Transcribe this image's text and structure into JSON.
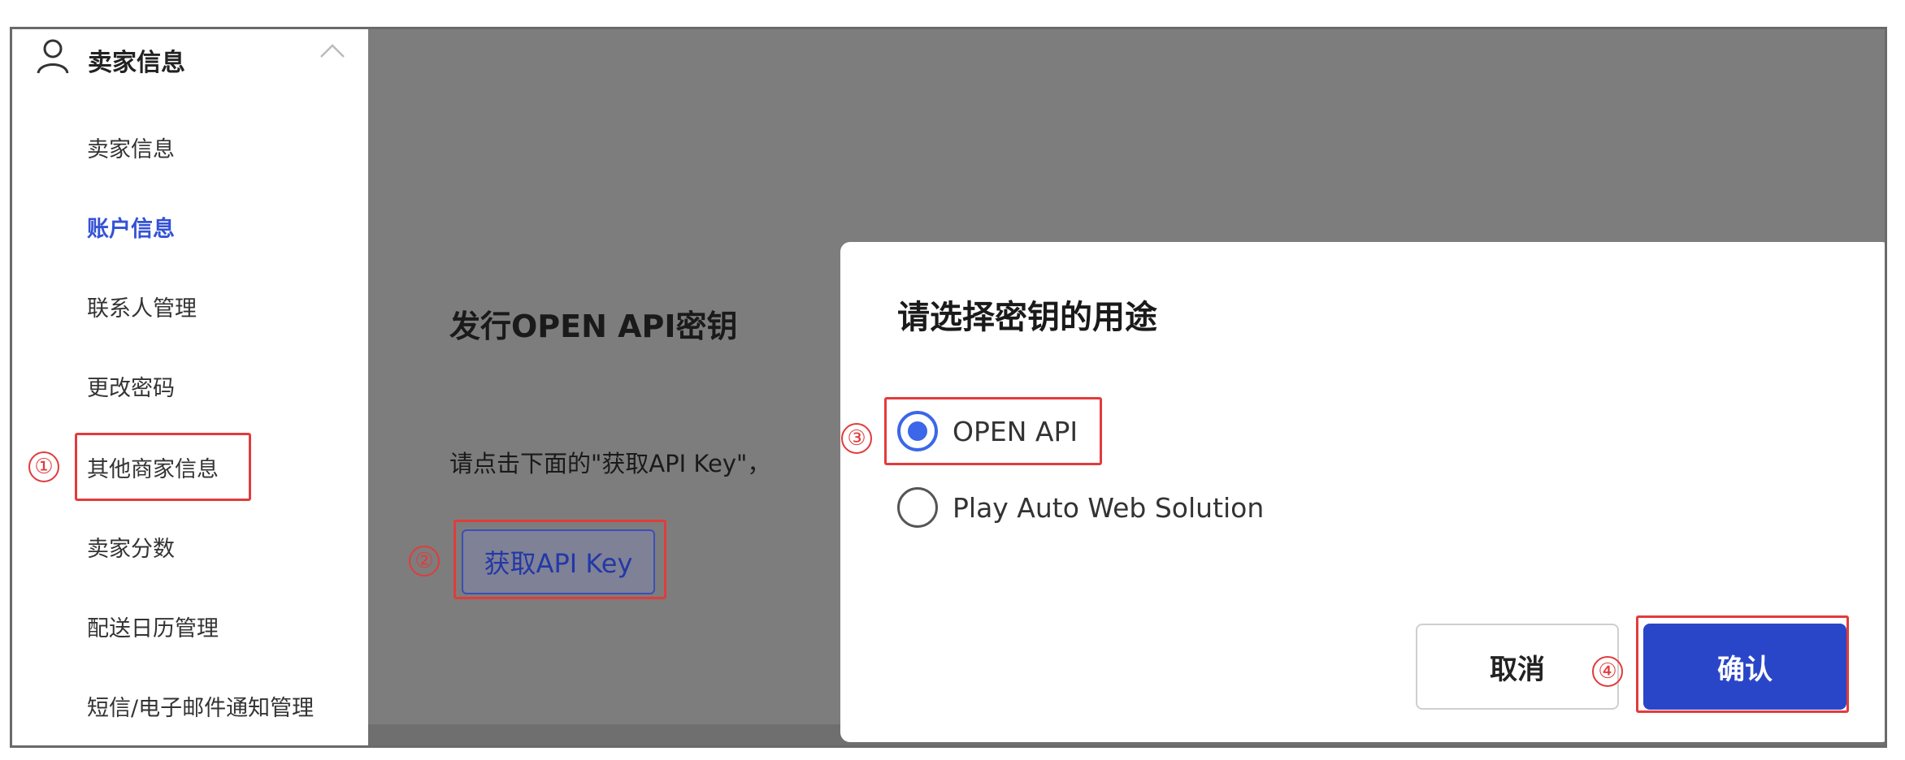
{
  "sidebar": {
    "header_title": "卖家信息",
    "items": [
      {
        "label": "卖家信息",
        "active": false
      },
      {
        "label": "账户信息",
        "active": true
      },
      {
        "label": "联系人管理",
        "active": false
      },
      {
        "label": "更改密码",
        "active": false
      },
      {
        "label": "其他商家信息",
        "active": false
      },
      {
        "label": "卖家分数",
        "active": false
      },
      {
        "label": "配送日历管理",
        "active": false
      },
      {
        "label": "短信/电子邮件通知管理",
        "active": false
      }
    ]
  },
  "background": {
    "title": "发行OPEN API密钥",
    "description": "请点击下面的\"获取API Key\"，",
    "get_key_button": "获取API Key"
  },
  "modal": {
    "title": "请选择密钥的用途",
    "options": [
      {
        "label": "OPEN API",
        "checked": true
      },
      {
        "label": "Play Auto Web Solution",
        "checked": false
      }
    ],
    "cancel_label": "取消",
    "confirm_label": "确认"
  },
  "annotations": {
    "step1": "①",
    "step2": "②",
    "step3": "③",
    "step4": "④"
  },
  "colors": {
    "accent": "#3452d6",
    "confirm": "#2a46c8",
    "annotation": "#e23b3b",
    "overlay": "#7d7d7d"
  }
}
